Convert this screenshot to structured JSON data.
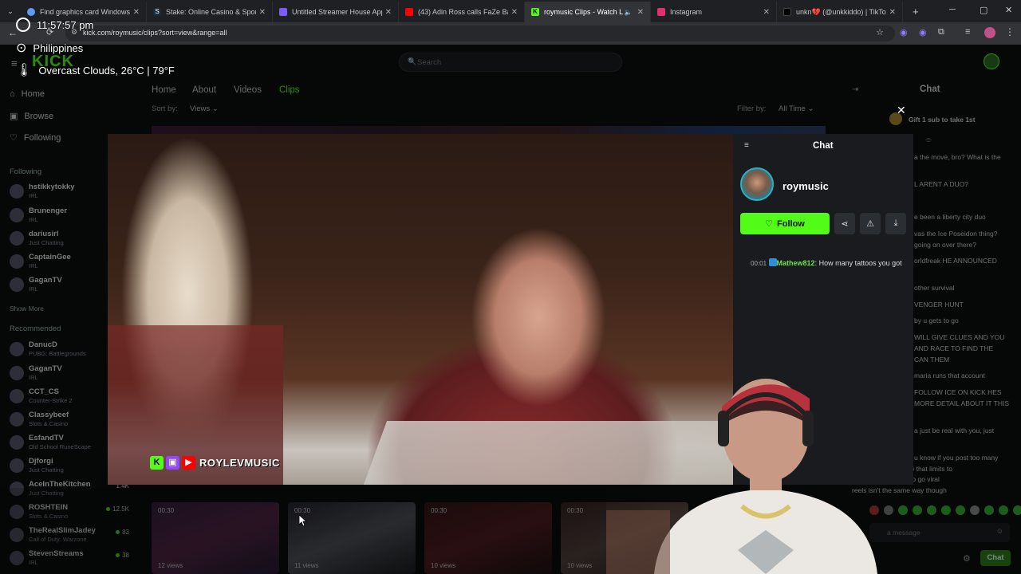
{
  "browser": {
    "tabs": [
      {
        "title": "Find graphics card Windows",
        "color": "#5f9bf5"
      },
      {
        "title": "Stake: Online Casino & Sports B",
        "color": "#1a2c38"
      },
      {
        "title": "Untitled Streamer House Apple",
        "color": "#7b5cf5"
      },
      {
        "title": "(43) Adin Ross calls FaZe Banks",
        "color": "#ff0000"
      },
      {
        "title": "roymusic Clips - Watch Live",
        "color": "#53fc18"
      },
      {
        "title": "Instagram",
        "color": "#e1306c"
      },
      {
        "title": "unkn💔 (@unkkiddo) | TikTok",
        "color": "#000000"
      }
    ],
    "new_tab": "+",
    "url": "kick.com/roymusic/clips?sort=view&range=all"
  },
  "os_overlay": {
    "time": "11:57:57 pm",
    "location": "Philippines",
    "weather": "Overcast Clouds, 26°C | 79°F"
  },
  "kick": {
    "logo": "KICK",
    "search_placeholder": "Search",
    "sidebar": {
      "home": "Home",
      "browse": "Browse",
      "following": "Following",
      "following_header": "Following",
      "show_more": "Show More",
      "recommended_header": "Recommended",
      "following_channels": [
        {
          "name": "hstikkytokky",
          "cat": "IRL"
        },
        {
          "name": "Brunenger",
          "cat": "IRL"
        },
        {
          "name": "dariusirl",
          "cat": "Just Chatting"
        },
        {
          "name": "CaptainGee",
          "cat": "IRL"
        },
        {
          "name": "GaganTV",
          "cat": "IRL"
        }
      ],
      "recommended_channels": [
        {
          "name": "DanucD",
          "cat": "PUBG: Battlegrounds",
          "views": ""
        },
        {
          "name": "GaganTV",
          "cat": "IRL",
          "views": ""
        },
        {
          "name": "CCT_CS",
          "cat": "Counter-Strike 2",
          "views": ""
        },
        {
          "name": "Classybeef",
          "cat": "Slots & Casino",
          "views": ""
        },
        {
          "name": "EsfandTV",
          "cat": "Old School RuneScape",
          "views": ""
        },
        {
          "name": "Djforgi",
          "cat": "Just Chatting",
          "views": ""
        },
        {
          "name": "AceInTheKitchen",
          "cat": "Just Chatting",
          "views": "1.4K"
        },
        {
          "name": "ROSHTEIN",
          "cat": "Slots & Casino",
          "views": "12.5K"
        },
        {
          "name": "TheRealSlimJadey",
          "cat": "Call of Duty: Warzone",
          "views": "83"
        },
        {
          "name": "StevenStreams",
          "cat": "IRL",
          "views": "38"
        }
      ]
    },
    "profile_tabs": [
      "Home",
      "About",
      "Videos",
      "Clips"
    ],
    "sort_by_label": "Sort by:",
    "sort_by_value": "Views",
    "filter_by_label": "Filter by:",
    "filter_by_value": "All Time",
    "right_chat": {
      "title": "Chat",
      "gift_text": "Gift 1 sub to take 1st",
      "lines": [
        "a the move, bro? What is the",
        "L ARENT A DUO?",
        "e been a liberty city duo",
        "vas the Ice Poseidon thing?",
        "going on over there?",
        "orldfreak HE ANNOUNCED",
        "other survival",
        "VENGER HUNT",
        "by u gets to go",
        "WILL GIVE CLUES AND YOU",
        "AND RACE TO FIND THE",
        "CAN THEM",
        "maria runs that account",
        "FOLLOW ICE ON KICK HES",
        "MORE DETAIL ABOUT IT THIS",
        "a just be real with you, just",
        "u know if you post too many",
        "amount of time that limits to",
        "and potential to go viral",
        "reels isn't the same way though"
      ],
      "input_placeholder": "a message",
      "send_label": "Chat"
    },
    "clips": [
      {
        "duration": "00:30",
        "views": "12 views"
      },
      {
        "duration": "00:30",
        "views": "11 views"
      },
      {
        "duration": "00:30",
        "views": "10 views"
      },
      {
        "duration": "00:30",
        "views": "10 views"
      }
    ]
  },
  "clip_modal": {
    "watermark": "ROYLEVMUSIC",
    "chat_title": "Chat",
    "channel_name": "roymusic",
    "follow_label": "Follow",
    "message": {
      "time": "00:01",
      "user": "Mathew812",
      "text": "How many tattoos you got"
    }
  }
}
